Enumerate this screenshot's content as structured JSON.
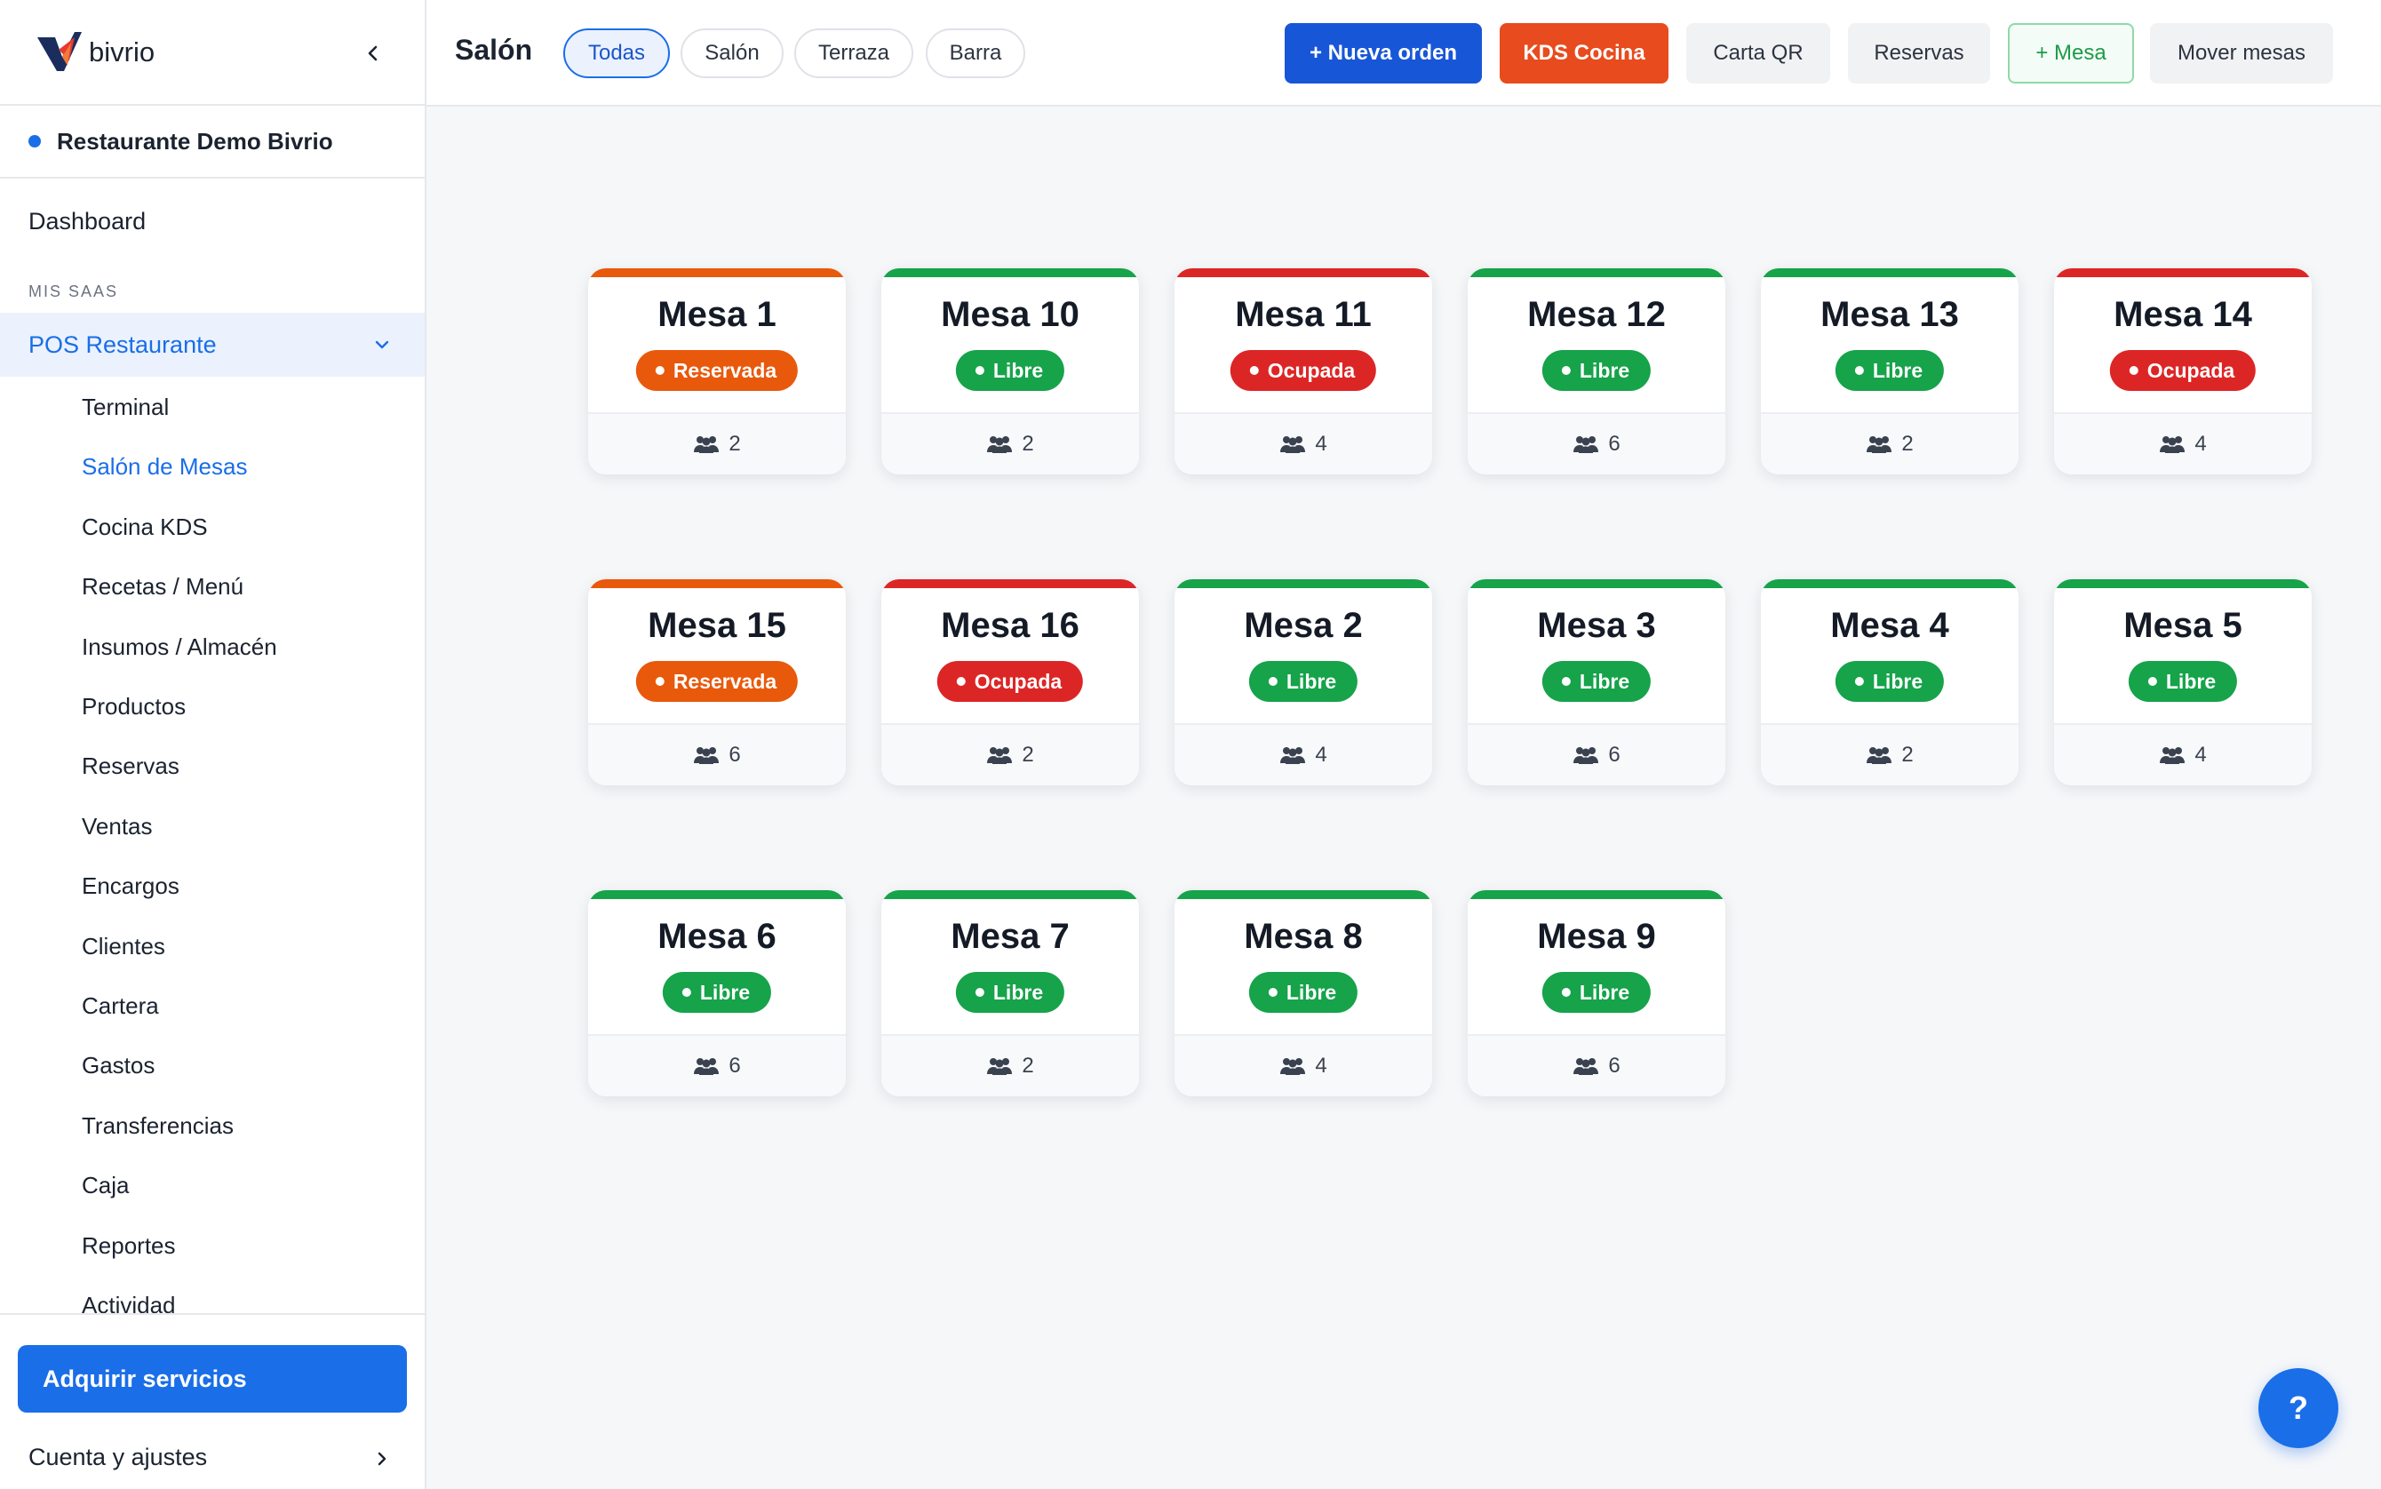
{
  "sidebar": {
    "brand": "bivrio",
    "organization": "Restaurante Demo Bivrio",
    "dashboard": "Dashboard",
    "section_label": "MIS SAAS",
    "group": "POS Restaurante",
    "items": [
      {
        "label": "Terminal"
      },
      {
        "label": "Salón de Mesas",
        "active": true
      },
      {
        "label": "Cocina KDS"
      },
      {
        "label": "Recetas / Menú"
      },
      {
        "label": "Insumos / Almacén"
      },
      {
        "label": "Productos"
      },
      {
        "label": "Reservas"
      },
      {
        "label": "Ventas"
      },
      {
        "label": "Encargos"
      },
      {
        "label": "Clientes"
      },
      {
        "label": "Cartera"
      },
      {
        "label": "Gastos"
      },
      {
        "label": "Transferencias"
      },
      {
        "label": "Caja"
      },
      {
        "label": "Reportes"
      },
      {
        "label": "Actividad"
      }
    ],
    "acquire_button": "Adquirir servicios",
    "account": "Cuenta y ajustes"
  },
  "header": {
    "title": "Salón",
    "filters": [
      {
        "label": "Todas",
        "active": true
      },
      {
        "label": "Salón"
      },
      {
        "label": "Terraza"
      },
      {
        "label": "Barra"
      }
    ],
    "actions": {
      "new_order": "+ Nueva orden",
      "kds": "KDS Cocina",
      "qr_menu": "Carta QR",
      "reservations": "Reservas",
      "add_table": "+ Mesa",
      "move_tables": "Mover mesas"
    }
  },
  "status_colors": {
    "reservada": "#e8590c",
    "libre": "#16a34a",
    "ocupada": "#dc2626"
  },
  "tables": [
    {
      "name": "Mesa 1",
      "status": "Reservada",
      "status_key": "reservada",
      "seats": "2"
    },
    {
      "name": "Mesa 10",
      "status": "Libre",
      "status_key": "libre",
      "seats": "2"
    },
    {
      "name": "Mesa 11",
      "status": "Ocupada",
      "status_key": "ocupada",
      "seats": "4"
    },
    {
      "name": "Mesa 12",
      "status": "Libre",
      "status_key": "libre",
      "seats": "6"
    },
    {
      "name": "Mesa 13",
      "status": "Libre",
      "status_key": "libre",
      "seats": "2"
    },
    {
      "name": "Mesa 14",
      "status": "Ocupada",
      "status_key": "ocupada",
      "seats": "4"
    },
    {
      "name": "Mesa 15",
      "status": "Reservada",
      "status_key": "reservada",
      "seats": "6"
    },
    {
      "name": "Mesa 16",
      "status": "Ocupada",
      "status_key": "ocupada",
      "seats": "2"
    },
    {
      "name": "Mesa 2",
      "status": "Libre",
      "status_key": "libre",
      "seats": "4"
    },
    {
      "name": "Mesa 3",
      "status": "Libre",
      "status_key": "libre",
      "seats": "6"
    },
    {
      "name": "Mesa 4",
      "status": "Libre",
      "status_key": "libre",
      "seats": "2"
    },
    {
      "name": "Mesa 5",
      "status": "Libre",
      "status_key": "libre",
      "seats": "4"
    },
    {
      "name": "Mesa 6",
      "status": "Libre",
      "status_key": "libre",
      "seats": "6"
    },
    {
      "name": "Mesa 7",
      "status": "Libre",
      "status_key": "libre",
      "seats": "2"
    },
    {
      "name": "Mesa 8",
      "status": "Libre",
      "status_key": "libre",
      "seats": "4"
    },
    {
      "name": "Mesa 9",
      "status": "Libre",
      "status_key": "libre",
      "seats": "6"
    }
  ],
  "help": {
    "label": "?"
  }
}
